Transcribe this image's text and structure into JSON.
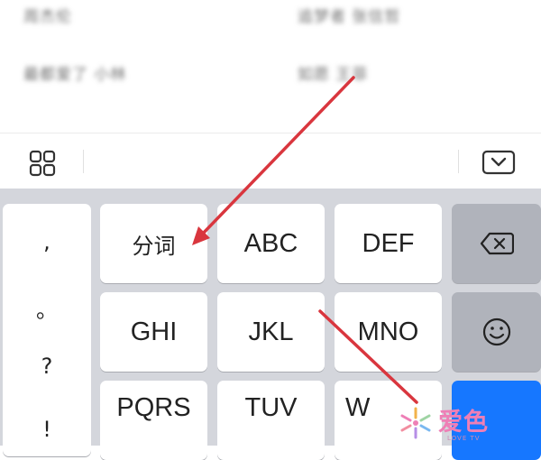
{
  "list": {
    "rows": [
      {
        "left": "周杰伦",
        "right": "追梦者 张信哲"
      },
      {
        "left": "最都爱了 小林",
        "right": "如愿 王菲"
      }
    ]
  },
  "toolbar": {
    "menu_icon": "grid-icon",
    "collapse_icon": "keyboard-collapse-icon"
  },
  "keyboard": {
    "punctuation": [
      ",",
      "。",
      "?",
      "!"
    ],
    "rows": [
      [
        "分词",
        "ABC",
        "DEF"
      ],
      [
        "GHI",
        "JKL",
        "MNO"
      ],
      [
        "PQRS",
        "TUV",
        "W"
      ]
    ],
    "delete_icon": "backspace-icon",
    "emoji_icon": "emoji-icon",
    "accent_color": "#1677ff"
  },
  "annotation": {
    "arrow_color": "#d9363e"
  },
  "watermark": {
    "logo_icon": "snowflake-logo-icon",
    "text": "爱色",
    "sub": "LOVE TV"
  }
}
